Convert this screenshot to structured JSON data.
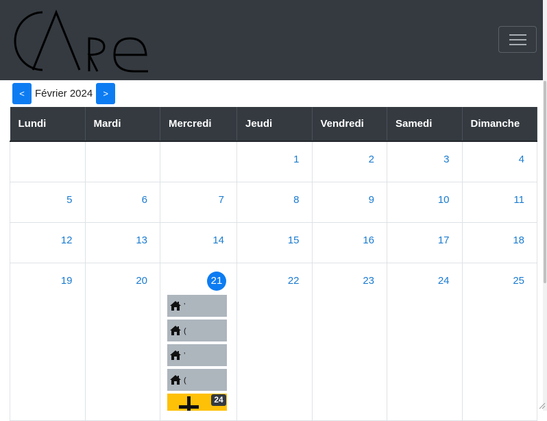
{
  "navbar": {
    "brand": "CARe",
    "brand_icon": "care-logo",
    "toggler_icon": "hamburger-icon"
  },
  "calendar": {
    "prev_label": "<",
    "next_label": ">",
    "month_label": "Février 2024",
    "weekdays": [
      "Lundi",
      "Mardi",
      "Mercredi",
      "Jeudi",
      "Vendredi",
      "Samedi",
      "Dimanche"
    ],
    "weeks": [
      [
        "",
        "",
        "",
        "1",
        "2",
        "3",
        "4"
      ],
      [
        "5",
        "6",
        "7",
        "8",
        "9",
        "10",
        "11"
      ],
      [
        "12",
        "13",
        "14",
        "15",
        "16",
        "17",
        "18"
      ],
      [
        "19",
        "20",
        "21",
        "22",
        "23",
        "24",
        "25"
      ]
    ],
    "today": "21",
    "events": [
      {
        "icon": "home-icon",
        "text": "ʼ"
      },
      {
        "icon": "home-icon",
        "text": "("
      },
      {
        "icon": "home-icon",
        "text": "ʼ"
      },
      {
        "icon": "home-icon",
        "text": "("
      }
    ],
    "more_badge": "24",
    "more_icon": "plus-icon"
  },
  "colors": {
    "navbar": "#343a40",
    "primary": "#0d7cf2",
    "event": "#adb5bd",
    "add": "#ffc107",
    "day_number": "#1a7bd0"
  }
}
